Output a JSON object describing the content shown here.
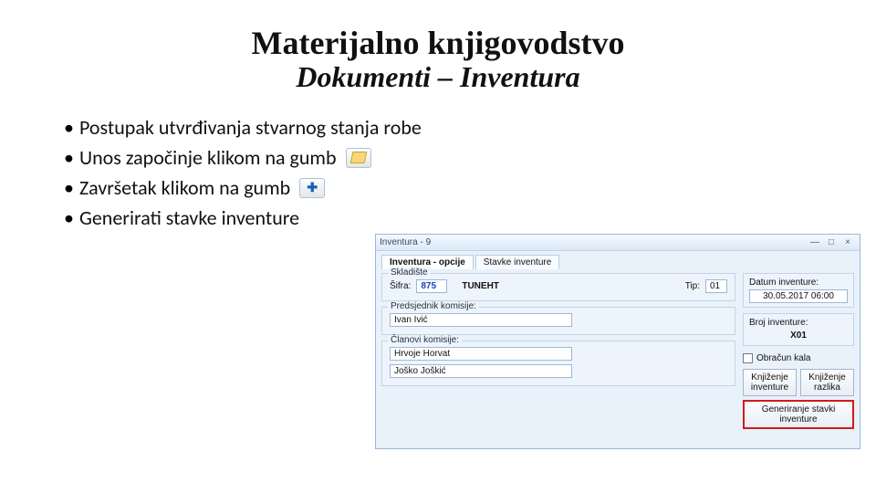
{
  "title": {
    "line1": "Materijalno knjigovodstvo",
    "line2": "Dokumenti – Inventura"
  },
  "bullets": {
    "b1": "Postupak utvrđivanja stvarnog stanja robe",
    "b2": "Unos započinje klikom na gumb",
    "b3": "Završetak klikom na gumb",
    "b4": "Generirati stavke inventure"
  },
  "win": {
    "title": "Inventura - 9",
    "tabs": {
      "t1": "Inventura - opcije",
      "t2": "Stavke inventure"
    },
    "skladiste": {
      "legend": "Skladište",
      "sifra_lbl": "Šifra:",
      "sifra_val": "875",
      "naziv": "TUNEHT",
      "tip_lbl": "Tip:",
      "tip_val": "01"
    },
    "predsjednik": {
      "legend": "Predsjednik komisije:",
      "val": "Ivan Ivić"
    },
    "clanovi": {
      "legend": "Članovi komisije:",
      "c1": "Hrvoje Horvat",
      "c2": "Joško Joškić"
    },
    "right": {
      "datum_lbl": "Datum inventure:",
      "datum_val": "30.05.2017 06:00",
      "broj_lbl": "Broj inventure:",
      "broj_val": "X01",
      "obracun": "Obračun kala",
      "btn_knj_inv": "Knjiženje inventure",
      "btn_knj_raz": "Knjiženje razlika",
      "btn_gen": "Generiranje stavki inventure"
    }
  }
}
